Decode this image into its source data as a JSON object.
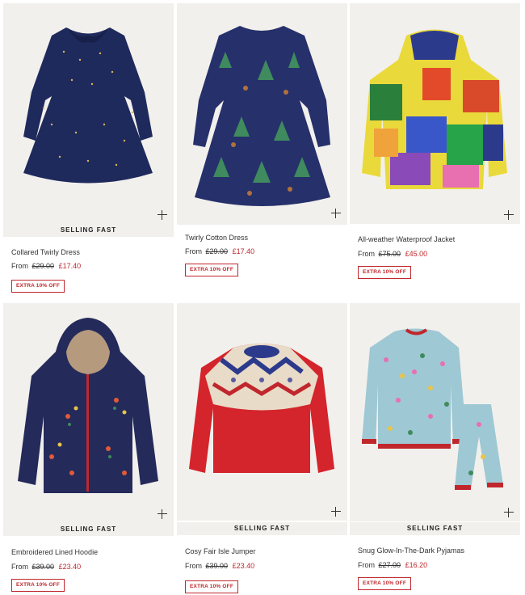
{
  "products": [
    {
      "name": "Collared Twirly Dress",
      "badge": "SELLING FAST",
      "from": "From",
      "old_price": "£29.00",
      "new_price": "£17.40",
      "promo": "EXTRA 10% OFF"
    },
    {
      "name": "Twirly Cotton Dress",
      "badge": "",
      "from": "From",
      "old_price": "£29.00",
      "new_price": "£17.40",
      "promo": "EXTRA 10% OFF"
    },
    {
      "name": "All-weather Waterproof Jacket",
      "badge": "",
      "from": "From",
      "old_price": "£75.00",
      "new_price": "£45.00",
      "promo": "EXTRA 10% OFF"
    },
    {
      "name": "Embroidered Lined Hoodie",
      "badge": "SELLING FAST",
      "from": "From",
      "old_price": "£39.00",
      "new_price": "£23.40",
      "promo": "EXTRA 10% OFF"
    },
    {
      "name": "Cosy Fair Isle Jumper",
      "badge": "SELLING FAST",
      "from": "From",
      "old_price": "£39.00",
      "new_price": "£23.40",
      "promo": "EXTRA 10% OFF"
    },
    {
      "name": "Snug Glow-In-The-Dark Pyjamas",
      "badge": "SELLING FAST",
      "from": "From",
      "old_price": "£27.00",
      "new_price": "£16.20",
      "promo": "EXTRA 10% OFF"
    }
  ],
  "colors": {
    "accent_red": "#c0272d",
    "image_bg": "#f2f0ec"
  },
  "icons": {
    "quick_add": "plus-icon"
  }
}
